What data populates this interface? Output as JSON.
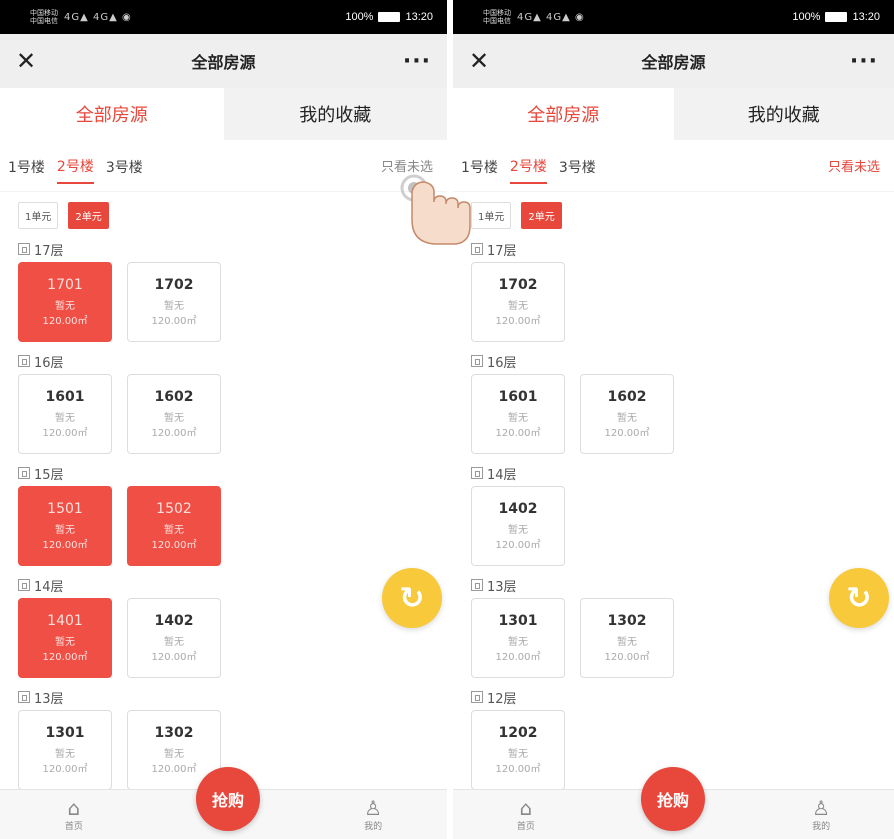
{
  "left": {
    "status": {
      "carrier1": "中国移动",
      "carrier2": "中国电信",
      "signal": "4G▲ 4G▲ ◉",
      "battery": "100%",
      "time": "13:20"
    },
    "nav": {
      "close": "✕",
      "title": "全部房源",
      "more": "···"
    },
    "tabs": [
      {
        "label": "全部房源"
      },
      {
        "label": "我的收藏"
      }
    ],
    "buildings": [
      {
        "label": "1号楼"
      },
      {
        "label": "2号楼"
      },
      {
        "label": "3号楼"
      }
    ],
    "filter": "只看未选",
    "units": [
      {
        "label": "1单元"
      },
      {
        "label": "2单元"
      }
    ],
    "floors": [
      {
        "label": "17层",
        "rooms": [
          {
            "no": "1701",
            "status": "暂无",
            "area": "120.00㎡",
            "sold": true
          },
          {
            "no": "1702",
            "status": "暂无",
            "area": "120.00㎡",
            "sold": false
          }
        ]
      },
      {
        "label": "16层",
        "rooms": [
          {
            "no": "1601",
            "status": "暂无",
            "area": "120.00㎡",
            "sold": false
          },
          {
            "no": "1602",
            "status": "暂无",
            "area": "120.00㎡",
            "sold": false
          }
        ]
      },
      {
        "label": "15层",
        "rooms": [
          {
            "no": "1501",
            "status": "暂无",
            "area": "120.00㎡",
            "sold": true
          },
          {
            "no": "1502",
            "status": "暂无",
            "area": "120.00㎡",
            "sold": true
          }
        ]
      },
      {
        "label": "14层",
        "rooms": [
          {
            "no": "1401",
            "status": "暂无",
            "area": "120.00㎡",
            "sold": true
          },
          {
            "no": "1402",
            "status": "暂无",
            "area": "120.00㎡",
            "sold": false
          }
        ]
      },
      {
        "label": "13层",
        "rooms": [
          {
            "no": "1301",
            "status": "暂无",
            "area": "120.00㎡",
            "sold": false
          },
          {
            "no": "1302",
            "status": "暂无",
            "area": "120.00㎡",
            "sold": false
          }
        ]
      }
    ],
    "bottom": {
      "home": "首页",
      "grab": "抢购",
      "mine": "我的"
    }
  },
  "right": {
    "status": {
      "carrier1": "中国移动",
      "carrier2": "中国电信",
      "signal": "4G▲ 4G▲ ◉",
      "battery": "100%",
      "time": "13:20"
    },
    "nav": {
      "close": "✕",
      "title": "全部房源",
      "more": "···"
    },
    "tabs": [
      {
        "label": "全部房源"
      },
      {
        "label": "我的收藏"
      }
    ],
    "buildings": [
      {
        "label": "1号楼"
      },
      {
        "label": "2号楼"
      },
      {
        "label": "3号楼"
      }
    ],
    "filter": "只看未选",
    "units": [
      {
        "label": "1单元"
      },
      {
        "label": "2单元"
      }
    ],
    "floors": [
      {
        "label": "17层",
        "rooms": [
          {
            "no": "1702",
            "status": "暂无",
            "area": "120.00㎡",
            "sold": false
          }
        ]
      },
      {
        "label": "16层",
        "rooms": [
          {
            "no": "1601",
            "status": "暂无",
            "area": "120.00㎡",
            "sold": false
          },
          {
            "no": "1602",
            "status": "暂无",
            "area": "120.00㎡",
            "sold": false
          }
        ]
      },
      {
        "label": "14层",
        "rooms": [
          {
            "no": "1402",
            "status": "暂无",
            "area": "120.00㎡",
            "sold": false
          }
        ]
      },
      {
        "label": "13层",
        "rooms": [
          {
            "no": "1301",
            "status": "暂无",
            "area": "120.00㎡",
            "sold": false
          },
          {
            "no": "1302",
            "status": "暂无",
            "area": "120.00㎡",
            "sold": false
          }
        ]
      },
      {
        "label": "12层",
        "rooms": [
          {
            "no": "1202",
            "status": "暂无",
            "area": "120.00㎡",
            "sold": false
          }
        ]
      }
    ],
    "bottom": {
      "home": "首页",
      "grab": "抢购",
      "mine": "我的"
    }
  },
  "icons": {
    "refresh": "refresh-icon",
    "home": "home-icon",
    "user": "user-icon",
    "building": "building-icon",
    "hand": "hand-pointer-icon"
  },
  "colors": {
    "accent": "#e8473b",
    "refresh": "#f7c93b",
    "nav_bg": "#efefef"
  }
}
